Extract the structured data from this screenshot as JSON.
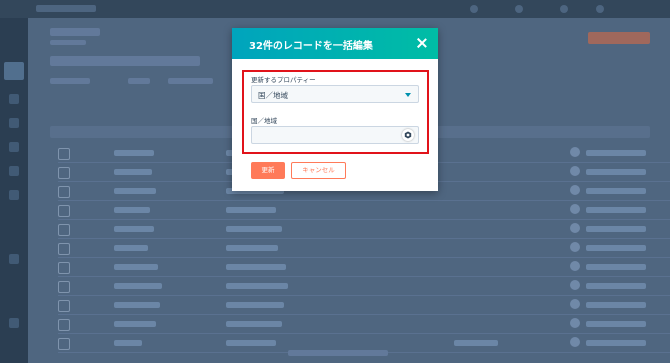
{
  "modal": {
    "title": "32件のレコードを一括編集",
    "property_label": "更新するプロパティー",
    "property_value": "国／地域",
    "field_label": "国／地域",
    "field_value": "",
    "update_button": "更新",
    "cancel_button": "キャンセル"
  },
  "colors": {
    "header_gradient_start": "#00a4bd",
    "header_gradient_end": "#00bda5",
    "highlight_border": "#e1131a",
    "primary_button": "#ff7a59",
    "background_overlay": "#4f6680"
  },
  "icons": {
    "close": "close-icon",
    "dropdown": "caret-down-icon",
    "field_badge": "hubspot-badge-icon"
  }
}
